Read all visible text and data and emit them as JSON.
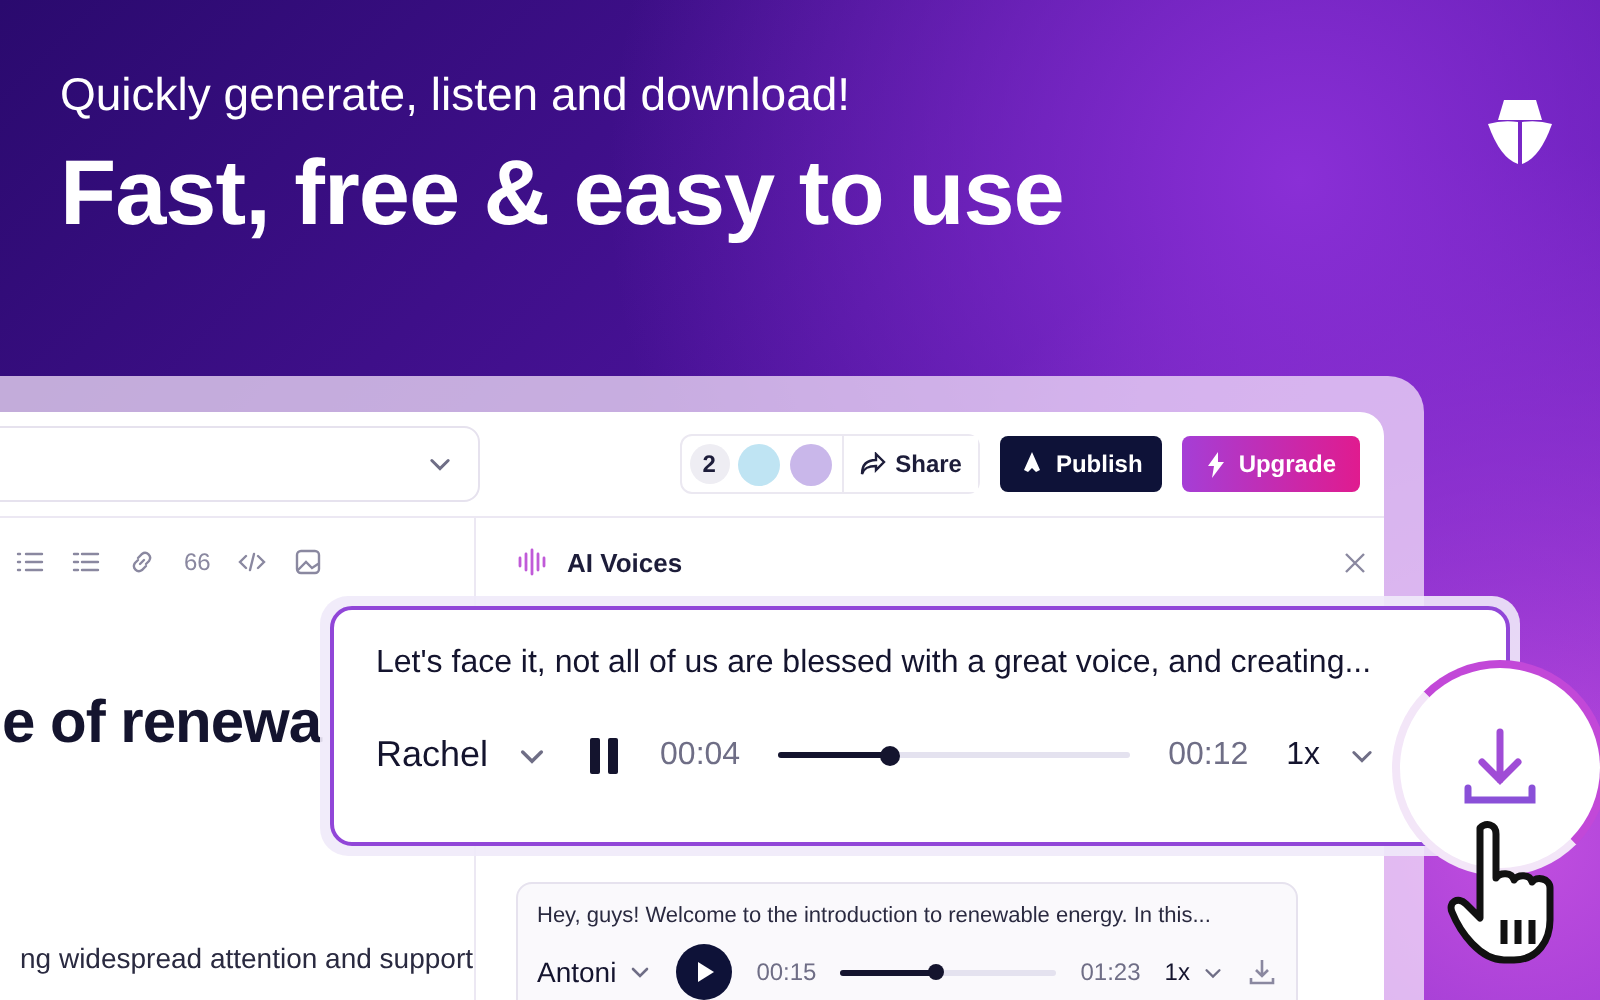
{
  "header": {
    "subtitle": "Quickly generate, listen and download!",
    "title": "Fast, free & easy to use"
  },
  "topbar": {
    "collaborator_count": "2",
    "share": "Share",
    "publish": "Publish",
    "upgrade": "Upgrade"
  },
  "toolbar": {
    "quote": "66"
  },
  "editor": {
    "heading": "e of renewa",
    "body": "ng widespread attention and support"
  },
  "panel": {
    "title": "AI Voices"
  },
  "player": {
    "text": "Let's face it, not all of us are blessed with a great voice, and creating...",
    "voice": "Rachel",
    "playing": true,
    "elapsed": "00:04",
    "level": 0.32,
    "duration": "00:12",
    "speed": "1x"
  },
  "clips": [
    {
      "text": "Hey, guys! Welcome to the introduction to renewable energy. In this...",
      "voice": "Antoni",
      "playing": false,
      "elapsed": "00:15",
      "level": 0.44,
      "duration": "01:23",
      "speed": "1x"
    }
  ]
}
